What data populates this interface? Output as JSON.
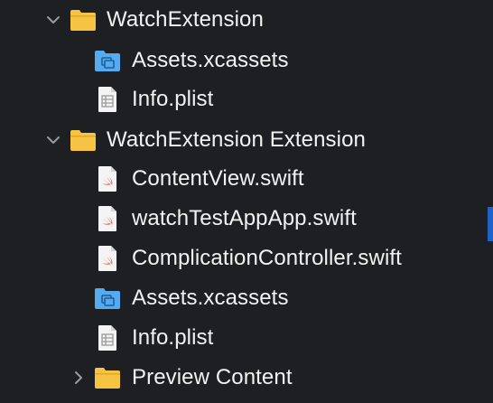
{
  "navigator": {
    "items": [
      {
        "label": "WatchExtension",
        "icon": "folder-icon",
        "disclosure": "expanded"
      },
      {
        "label": "Assets.xcassets",
        "icon": "asset-catalog-icon"
      },
      {
        "label": "Info.plist",
        "icon": "plist-file-icon"
      },
      {
        "label": "WatchExtension Extension",
        "icon": "folder-icon",
        "disclosure": "expanded"
      },
      {
        "label": "ContentView.swift",
        "icon": "swift-file-icon"
      },
      {
        "label": "watchTestAppApp.swift",
        "icon": "swift-file-icon"
      },
      {
        "label": "ComplicationController.swift",
        "icon": "swift-file-icon"
      },
      {
        "label": "Assets.xcassets",
        "icon": "asset-catalog-icon"
      },
      {
        "label": "Info.plist",
        "icon": "plist-file-icon"
      },
      {
        "label": "Preview Content",
        "icon": "folder-icon",
        "disclosure": "collapsed"
      }
    ]
  },
  "colors": {
    "background": "#1e1f22",
    "folder": "#f6c343",
    "asset_catalog": "#55aaf0",
    "swift": "#f05138",
    "text": "#f2f2f2",
    "scroll_indicator": "#1f62c8"
  }
}
